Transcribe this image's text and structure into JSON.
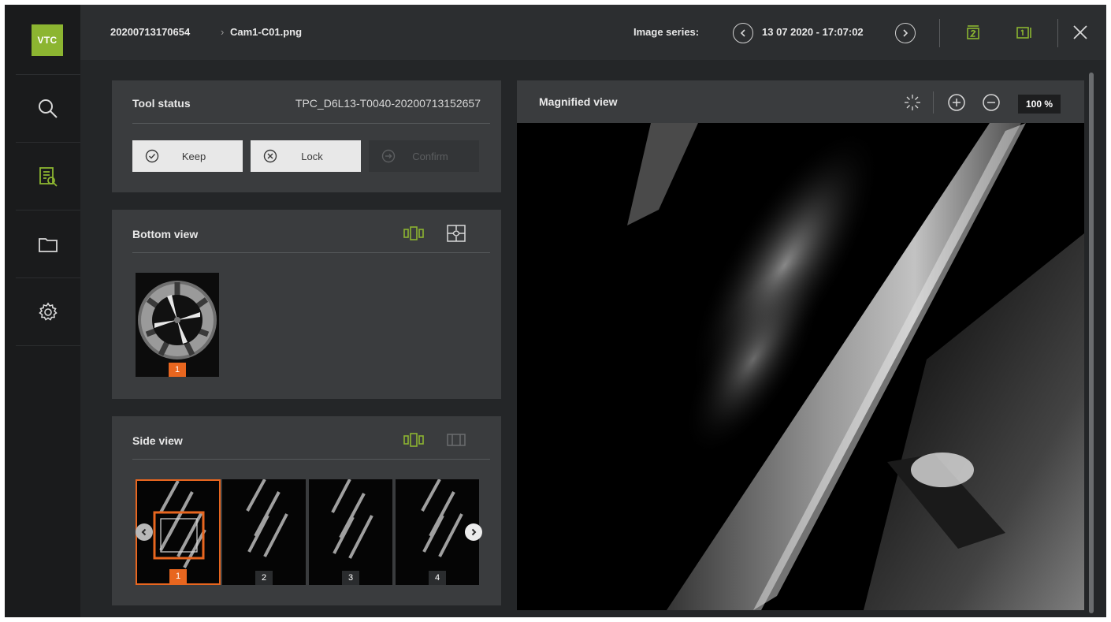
{
  "app": {
    "logo_text": "VTC"
  },
  "breadcrumb": {
    "root": "20200713170654",
    "separator": "›",
    "file": "Cam1-C01.png"
  },
  "series": {
    "label": "Image series:",
    "date": "13 07 2020 - 17:07:02"
  },
  "sidebar": {
    "items": [
      {
        "name": "search",
        "icon": "magnifier-icon"
      },
      {
        "name": "tool-inspection",
        "icon": "list-magnifier-icon",
        "accent": "#8cb531"
      },
      {
        "name": "files",
        "icon": "folder-icon"
      },
      {
        "name": "settings",
        "icon": "gear-icon"
      }
    ]
  },
  "tool_status": {
    "title": "Tool status",
    "tool_id": "TPC_D6L13-T0040-20200713152657",
    "buttons": {
      "keep": "Keep",
      "lock": "Lock",
      "confirm": "Confirm"
    }
  },
  "bottom_view": {
    "title": "Bottom view",
    "thumbs": [
      "1"
    ],
    "selected": "1"
  },
  "side_view": {
    "title": "Side view",
    "thumbs": [
      "1",
      "2",
      "3",
      "4"
    ],
    "selected": "1"
  },
  "magnified": {
    "title": "Magnified view",
    "zoom": "100 %"
  },
  "colors": {
    "accent_green": "#8cb531",
    "accent_orange": "#e8661f",
    "panel": "#3a3c3e",
    "background": "#242628"
  }
}
